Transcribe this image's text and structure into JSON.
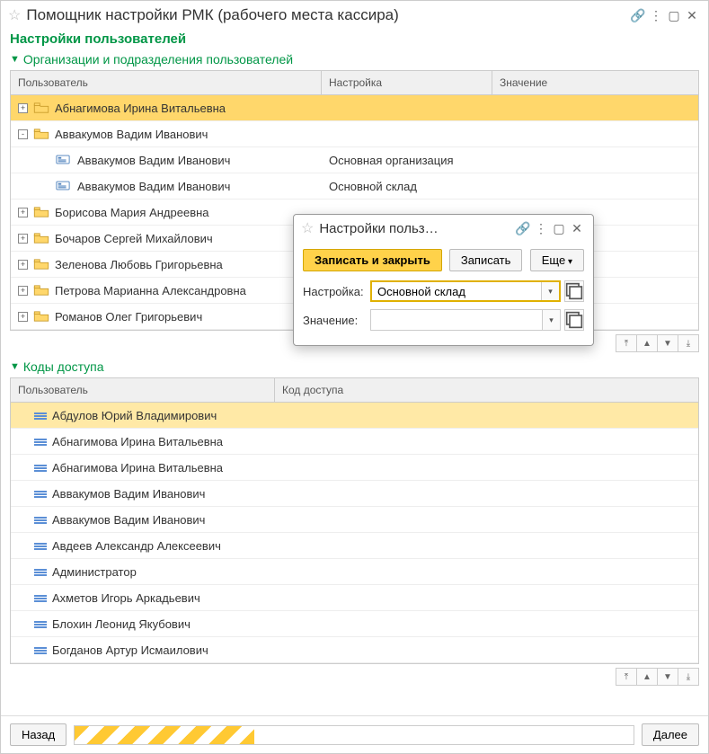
{
  "window": {
    "title": "Помощник настройки РМК (рабочего места кассира)"
  },
  "section_title": "Настройки пользователей",
  "group1": {
    "header": "Организации и подразделения пользователей",
    "columns": {
      "c1": "Пользователь",
      "c2": "Настройка",
      "c3": "Значение"
    },
    "rows": [
      {
        "type": "folder",
        "expand": "+",
        "name": "Абнагимова Ирина Витальевна",
        "selected": true
      },
      {
        "type": "folder",
        "expand": "-",
        "name": "Аввакумов Вадим Иванович"
      },
      {
        "type": "leaf",
        "name": "Аввакумов Вадим Иванович",
        "setting": "Основная организация"
      },
      {
        "type": "leaf",
        "name": "Аввакумов Вадим Иванович",
        "setting": "Основной склад"
      },
      {
        "type": "folder",
        "expand": "+",
        "name": "Борисова Мария Андреевна"
      },
      {
        "type": "folder",
        "expand": "+",
        "name": "Бочаров Сергей Михайлович"
      },
      {
        "type": "folder",
        "expand": "+",
        "name": "Зеленова Любовь Григорьевна"
      },
      {
        "type": "folder",
        "expand": "+",
        "name": "Петрова Марианна Александровна"
      },
      {
        "type": "folder",
        "expand": "+",
        "name": "Романов Олег Григорьевич"
      }
    ]
  },
  "group2": {
    "header": "Коды доступа",
    "columns": {
      "c1": "Пользователь",
      "c2": "Код доступа"
    },
    "rows": [
      {
        "name": "Абдулов Юрий Владимирович",
        "selected": true
      },
      {
        "name": "Абнагимова Ирина Витальевна"
      },
      {
        "name": "Абнагимова Ирина Витальевна"
      },
      {
        "name": "Аввакумов Вадим Иванович"
      },
      {
        "name": "Аввакумов Вадим Иванович"
      },
      {
        "name": "Авдеев Александр Алексеевич"
      },
      {
        "name": "Администратор"
      },
      {
        "name": "Ахметов Игорь Аркадьевич"
      },
      {
        "name": "Блохин Леонид Якубович"
      },
      {
        "name": "Богданов Артур Исмаилович"
      }
    ]
  },
  "footer": {
    "back": "Назад",
    "next": "Далее"
  },
  "popup": {
    "title": "Настройки польз…",
    "save_close": "Записать и закрыть",
    "save": "Записать",
    "more": "Еще",
    "label_setting": "Настройка:",
    "label_value": "Значение:",
    "setting_value": "Основной склад",
    "value_value": ""
  }
}
